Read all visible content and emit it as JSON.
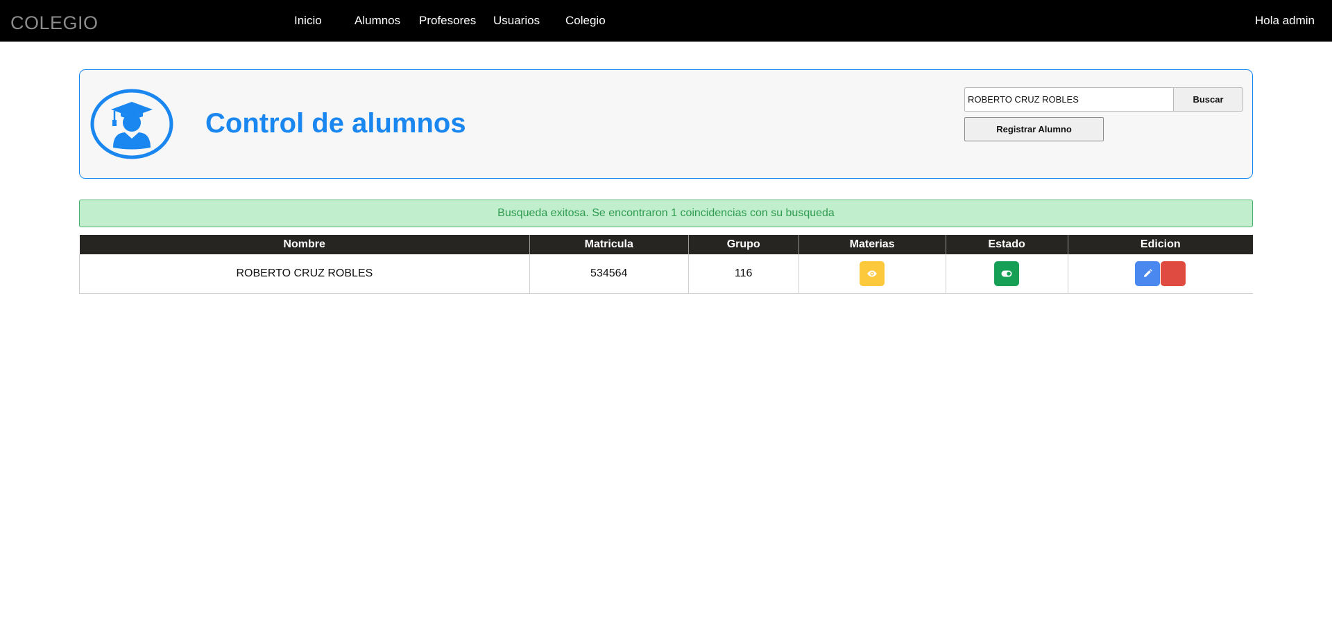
{
  "navbar": {
    "brand": "COLEGIO",
    "links": [
      {
        "label": "Inicio"
      },
      {
        "label": "Alumnos"
      },
      {
        "label": "Profesores"
      },
      {
        "label": "Usuarios"
      },
      {
        "label": "Colegio"
      }
    ],
    "greeting": "Hola admin"
  },
  "header": {
    "title": "Control de alumnos",
    "logo_icon": "graduate-student-icon",
    "search_value": "ROBERTO CRUZ ROBLES",
    "search_button": "Buscar",
    "register_button": "Registrar Alumno"
  },
  "alert": {
    "message": "Busqueda exitosa. Se encontraron 1 coincidencias con su busqueda",
    "color": "#2f9a50"
  },
  "table": {
    "columns": [
      "Nombre",
      "Matricula",
      "Grupo",
      "Materias",
      "Estado",
      "Edicion"
    ],
    "rows": [
      {
        "nombre": "ROBERTO CRUZ ROBLES",
        "matricula": "534564",
        "grupo": "116",
        "materias_icon": "eye-icon",
        "estado_icon": "toggle-on-icon",
        "edit_icon": "pencil-icon",
        "delete_icon": "trash-icon"
      }
    ]
  },
  "colors": {
    "accent": "#1a86f0",
    "view": "#fdc93c",
    "status": "#16a055",
    "edit": "#4a88f0",
    "delete": "#df4b40"
  }
}
